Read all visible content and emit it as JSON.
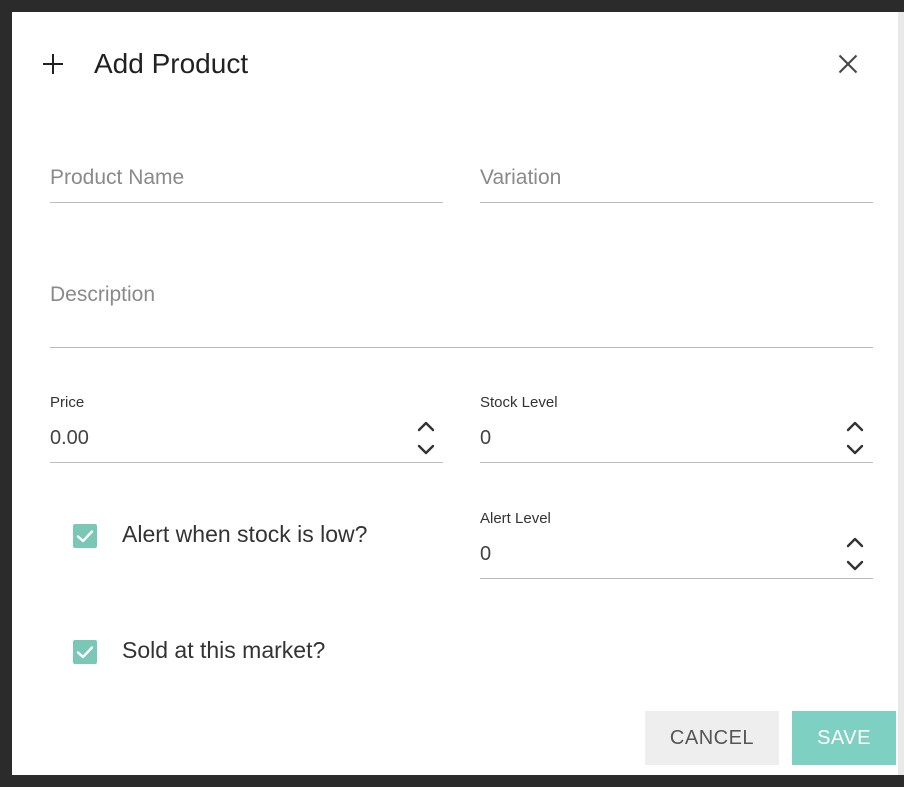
{
  "dialog": {
    "title": "Add Product"
  },
  "fields": {
    "product_name": {
      "placeholder": "Product Name",
      "value": ""
    },
    "variation": {
      "placeholder": "Variation",
      "value": ""
    },
    "description": {
      "placeholder": "Description",
      "value": ""
    },
    "price": {
      "label": "Price",
      "value": "0.00"
    },
    "stock_level": {
      "label": "Stock Level",
      "value": "0"
    },
    "alert_level": {
      "label": "Alert Level",
      "value": "0"
    }
  },
  "checkboxes": {
    "alert_low": {
      "label": "Alert when stock is low?",
      "checked": true
    },
    "sold_here": {
      "label": "Sold at this market?",
      "checked": true
    }
  },
  "buttons": {
    "cancel": "CANCEL",
    "save": "SAVE"
  },
  "colors": {
    "accent": "#7ac7b8",
    "save_button": "#7ed0c2",
    "cancel_button": "#eeeeee",
    "frame": "#2b2b2b"
  },
  "icons": {
    "header": "plus-icon",
    "close": "close-icon",
    "stepper": "chevron-up-down-icon",
    "check": "checkmark-icon"
  }
}
